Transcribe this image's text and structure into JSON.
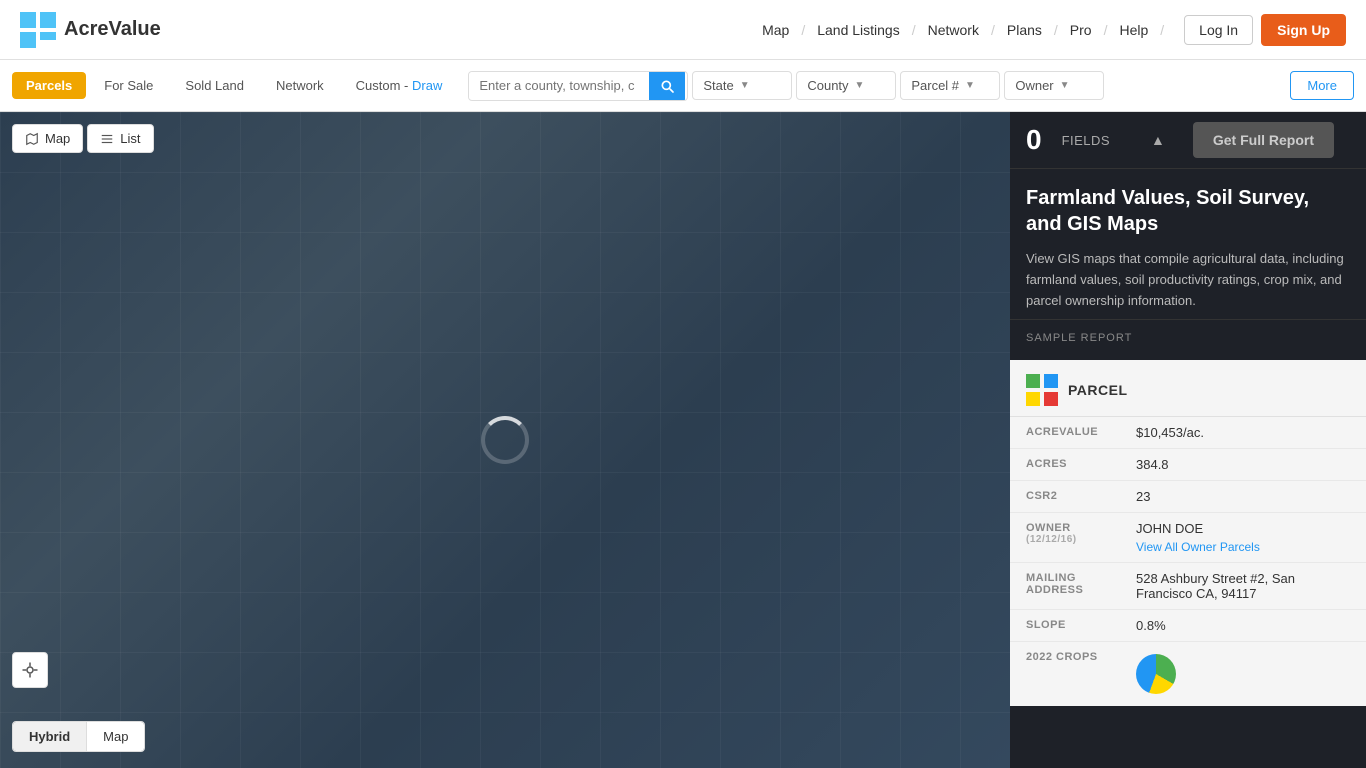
{
  "header": {
    "logo_text": "AcreValue",
    "nav": {
      "items": [
        {
          "label": "Map",
          "separator": true
        },
        {
          "label": "Land Listings",
          "separator": true
        },
        {
          "label": "Network",
          "separator": true
        },
        {
          "label": "Plans",
          "separator": true
        },
        {
          "label": "Pro",
          "separator": true
        },
        {
          "label": "Help",
          "separator": true
        }
      ],
      "login_label": "Log In",
      "signup_label": "Sign Up"
    }
  },
  "toolbar": {
    "tabs": [
      {
        "label": "Parcels",
        "active": true
      },
      {
        "label": "For Sale",
        "active": false
      },
      {
        "label": "Sold Land",
        "active": false
      },
      {
        "label": "Network",
        "active": false
      },
      {
        "label": "Custom",
        "active": false
      },
      {
        "label": "Draw",
        "active": false,
        "is_draw": true
      }
    ],
    "search_placeholder": "Enter a county, township, c",
    "filters": [
      {
        "label": "State",
        "has_dropdown": true
      },
      {
        "label": "County",
        "has_dropdown": true
      },
      {
        "label": "Parcel #",
        "has_dropdown": true
      },
      {
        "label": "Owner",
        "has_dropdown": true
      }
    ],
    "more_label": "More"
  },
  "map": {
    "view_modes": [
      {
        "label": "Map",
        "icon": "map-icon",
        "active": true
      },
      {
        "label": "List",
        "icon": "list-icon",
        "active": false
      }
    ],
    "type_modes": [
      {
        "label": "Hybrid",
        "active": true
      },
      {
        "label": "Map",
        "active": false
      }
    ]
  },
  "panel": {
    "fields_count": "0",
    "fields_label": "FIELDS",
    "get_report_label": "Get Full Report",
    "title": "Farmland Values, Soil Survey, and GIS Maps",
    "description": "View GIS maps that compile agricultural data, including farmland values, soil productivity ratings, crop mix, and parcel ownership information.",
    "sample_report_label": "SAMPLE REPORT",
    "parcel": {
      "header_label": "PARCEL",
      "rows": [
        {
          "label": "ACREVALUE",
          "value": "$10,453/ac.",
          "sublabel": null
        },
        {
          "label": "ACRES",
          "value": "384.8",
          "sublabel": null
        },
        {
          "label": "CSR2",
          "value": "23",
          "sublabel": null
        },
        {
          "label": "OWNER",
          "value": "JOHN DOE",
          "sublabel": "(12/12/16)",
          "link": "View All Owner Parcels"
        },
        {
          "label": "MAILING ADDRESS",
          "value": "528 Ashbury Street #2, San Francisco CA, 94117",
          "sublabel": null
        },
        {
          "label": "SLOPE",
          "value": "0.8%",
          "sublabel": null
        },
        {
          "label": "2022 CROPS",
          "value": "",
          "sublabel": null
        }
      ]
    }
  }
}
